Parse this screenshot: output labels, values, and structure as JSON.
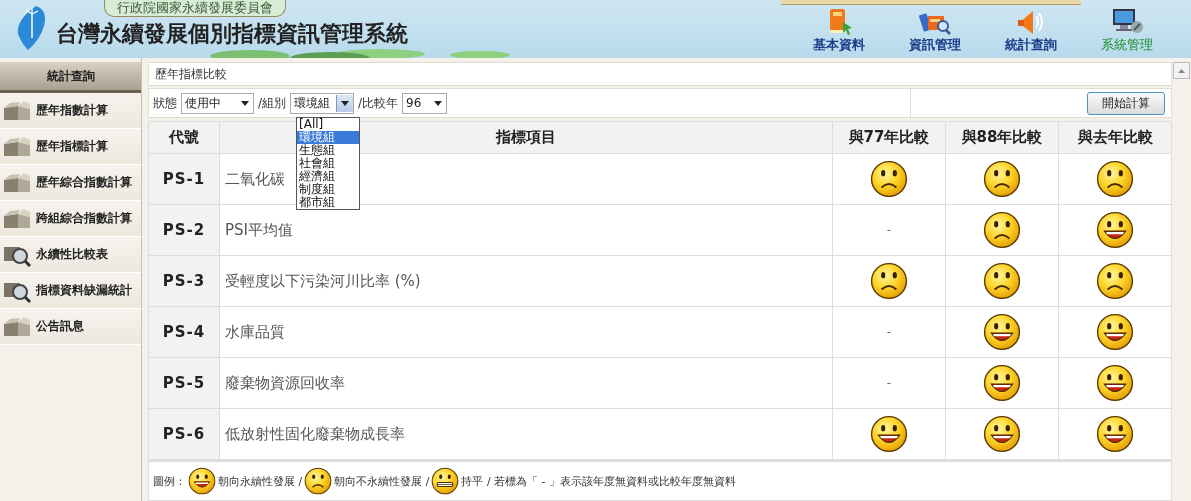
{
  "header": {
    "agency": "行政院國家永續發展委員會",
    "title": "台灣永續發展個別指標資訊管理系統",
    "nav": [
      {
        "label": "基本資料",
        "selected": false
      },
      {
        "label": "資訊管理",
        "selected": false
      },
      {
        "label": "統計查詢",
        "selected": false
      },
      {
        "label": "系統管理",
        "selected": true
      }
    ]
  },
  "sidebar": {
    "title": "統計查詢",
    "items": [
      {
        "label": "歷年指數計算"
      },
      {
        "label": "歷年指標計算"
      },
      {
        "label": "歷年綜合指數計算"
      },
      {
        "label": "跨組綜合指數計算"
      },
      {
        "label": "永續性比較表"
      },
      {
        "label": "指標資料缺漏統計"
      },
      {
        "label": "公告訊息"
      }
    ]
  },
  "main": {
    "breadcrumb": "歷年指標比較",
    "filters": [
      {
        "label": "狀態",
        "value": "使用中",
        "open": false
      },
      {
        "label": "/組別",
        "value": "環境組",
        "open": true,
        "options": [
          {
            "label": "[All]",
            "selected": false
          },
          {
            "label": "環境組",
            "selected": true
          },
          {
            "label": "生態組",
            "selected": false
          },
          {
            "label": "社會組",
            "selected": false
          },
          {
            "label": "經濟組",
            "selected": false
          },
          {
            "label": "制度組",
            "selected": false
          },
          {
            "label": "都市組",
            "selected": false
          }
        ]
      },
      {
        "label": "/比較年",
        "value": "96",
        "open": false
      }
    ],
    "button": "開始計算",
    "table": {
      "columns": [
        "代號",
        "指標項目",
        "與77年比較",
        "與88年比較",
        "與去年比較"
      ],
      "rows": [
        {
          "code": "PS-1",
          "item": "二氧化碳",
          "cells": [
            {
              "kind": "sad"
            },
            {
              "kind": "sad"
            },
            {
              "kind": "sad"
            }
          ]
        },
        {
          "code": "PS-2",
          "item": "PSI平均值",
          "cells": [
            {
              "kind": "none",
              "text": "-"
            },
            {
              "kind": "sad"
            },
            {
              "kind": "happy"
            }
          ]
        },
        {
          "code": "PS-3",
          "item": "受輕度以下污染河川比率 (%)",
          "cells": [
            {
              "kind": "sad"
            },
            {
              "kind": "sad"
            },
            {
              "kind": "sad"
            }
          ]
        },
        {
          "code": "PS-4",
          "item": "水庫品質",
          "cells": [
            {
              "kind": "none",
              "text": "-"
            },
            {
              "kind": "happy"
            },
            {
              "kind": "happy"
            }
          ]
        },
        {
          "code": "PS-5",
          "item": "廢棄物資源回收率",
          "cells": [
            {
              "kind": "none",
              "text": "-"
            },
            {
              "kind": "happy"
            },
            {
              "kind": "happy"
            }
          ]
        },
        {
          "code": "PS-6",
          "item": "低放射性固化廢棄物成長率",
          "cells": [
            {
              "kind": "happy"
            },
            {
              "kind": "happy"
            },
            {
              "kind": "happy"
            }
          ]
        }
      ]
    },
    "legend": {
      "label": "圖例：",
      "items": [
        {
          "kind": "happy",
          "text": "朝向永續性發展 /"
        },
        {
          "kind": "sad",
          "text": "朝向不永續性發展 /"
        },
        {
          "kind": "neutral",
          "text": "持平 / 若標為「 - 」表示該年度無資料或比較年度無資料"
        }
      ]
    }
  }
}
